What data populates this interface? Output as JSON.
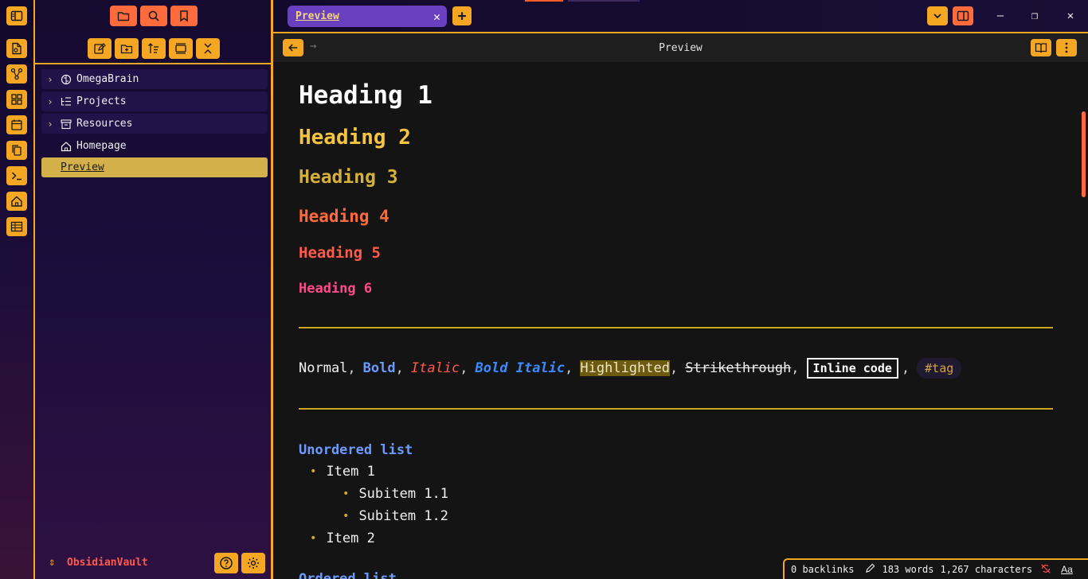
{
  "ribbon": {
    "icons": [
      "sidebar-toggle-icon",
      "new-note-icon",
      "graph-icon",
      "dashboard-icon",
      "calendar-icon",
      "copy-icon",
      "terminal-icon",
      "home-icon",
      "table-icon"
    ]
  },
  "sidebar": {
    "top_buttons": [
      "files-icon",
      "search-icon",
      "bookmark-icon"
    ],
    "nav_buttons": [
      "new-note-icon",
      "new-folder-icon",
      "sort-icon",
      "collapse-icon",
      "close-all-icon"
    ],
    "items": [
      {
        "label": "OmegaBrain",
        "icon": "brain-icon",
        "folder": true
      },
      {
        "label": "Projects",
        "icon": "list-tree-icon",
        "folder": true
      },
      {
        "label": "Resources",
        "icon": "archive-icon",
        "folder": true
      },
      {
        "label": "Homepage",
        "icon": "home-icon",
        "folder": false
      },
      {
        "label": "Preview",
        "icon": "",
        "folder": false,
        "active": true
      }
    ],
    "vault_name": "ObsidianVault"
  },
  "tabs": {
    "active_label": "Preview"
  },
  "view": {
    "title": "Preview"
  },
  "content": {
    "headings": [
      "Heading 1",
      "Heading 2",
      "Heading 3",
      "Heading 4",
      "Heading 5",
      "Heading 6"
    ],
    "inline": {
      "normal": "Normal",
      "bold": "Bold",
      "italic": "Italic",
      "bold_italic": "Bold Italic",
      "highlighted": "Highlighted",
      "strikethrough": "Strikethrough",
      "code": "Inline code",
      "tag": "#tag",
      "comma": ","
    },
    "unordered_title": "Unordered list",
    "list": {
      "item1": "Item 1",
      "sub1": "Subitem 1.1",
      "sub2": "Subitem 1.2",
      "item2": "Item 2"
    },
    "ordered_title": "Ordered list"
  },
  "status": {
    "backlinks": "0 backlinks",
    "words": "183 words",
    "characters": "1,267 characters",
    "font_toggle": "Aa"
  },
  "colors": {
    "accent": "#f5a623",
    "tab_active": "#6a3fc0",
    "vault_name": "#ff5a4a"
  }
}
